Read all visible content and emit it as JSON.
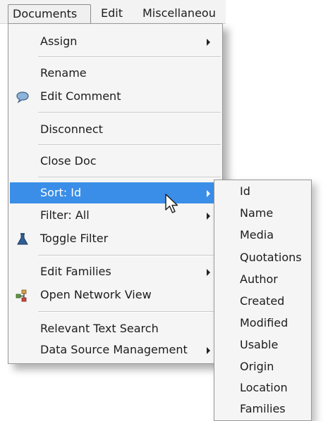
{
  "menubar": {
    "items": [
      "Documents",
      "Edit",
      "Miscellaneou"
    ]
  },
  "menu": {
    "assign": "Assign",
    "rename": "Rename",
    "edit_comment": "Edit Comment",
    "disconnect": "Disconnect",
    "close_doc": "Close Doc",
    "sort": "Sort: Id",
    "filter": "Filter: All",
    "toggle_filter": "Toggle Filter",
    "edit_families": "Edit Families",
    "open_network_view": "Open Network View",
    "relevant_text_search": "Relevant Text Search",
    "data_source_management": "Data Source Management"
  },
  "submenu": {
    "items": [
      "Id",
      "Name",
      "Media",
      "Quotations",
      "Author",
      "Created",
      "Modified",
      "Usable",
      "Origin",
      "Location",
      "Families"
    ]
  },
  "colors": {
    "highlight": "#3a8ee8",
    "menu_bg": "#f5f5f5"
  },
  "icons": {
    "edit_comment": "speech-bubble-icon",
    "toggle_filter": "flask-icon",
    "open_network_view": "network-icon",
    "cursor": "mouse-pointer-icon"
  }
}
